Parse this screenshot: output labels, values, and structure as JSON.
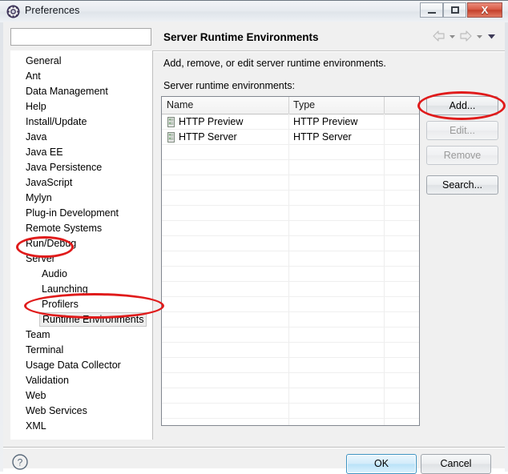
{
  "window": {
    "title": "Preferences",
    "icon": "gear-icon",
    "controls": {
      "minimize": "minimize-icon",
      "maximize": "restore-icon",
      "close": "X"
    }
  },
  "filter": {
    "value": "",
    "placeholder": ""
  },
  "sidebar": {
    "items": [
      {
        "label": "General",
        "indent": 0,
        "selected": false
      },
      {
        "label": "Ant",
        "indent": 0,
        "selected": false
      },
      {
        "label": "Data Management",
        "indent": 0,
        "selected": false
      },
      {
        "label": "Help",
        "indent": 0,
        "selected": false
      },
      {
        "label": "Install/Update",
        "indent": 0,
        "selected": false
      },
      {
        "label": "Java",
        "indent": 0,
        "selected": false
      },
      {
        "label": "Java EE",
        "indent": 0,
        "selected": false
      },
      {
        "label": "Java Persistence",
        "indent": 0,
        "selected": false
      },
      {
        "label": "JavaScript",
        "indent": 0,
        "selected": false
      },
      {
        "label": "Mylyn",
        "indent": 0,
        "selected": false
      },
      {
        "label": "Plug-in Development",
        "indent": 0,
        "selected": false
      },
      {
        "label": "Remote Systems",
        "indent": 0,
        "selected": false
      },
      {
        "label": "Run/Debug",
        "indent": 0,
        "selected": false
      },
      {
        "label": "Server",
        "indent": 0,
        "selected": false
      },
      {
        "label": "Audio",
        "indent": 1,
        "selected": false
      },
      {
        "label": "Launching",
        "indent": 1,
        "selected": false
      },
      {
        "label": "Profilers",
        "indent": 1,
        "selected": false
      },
      {
        "label": "Runtime Environments",
        "indent": 1,
        "selected": true
      },
      {
        "label": "Team",
        "indent": 0,
        "selected": false
      },
      {
        "label": "Terminal",
        "indent": 0,
        "selected": false
      },
      {
        "label": "Usage Data Collector",
        "indent": 0,
        "selected": false
      },
      {
        "label": "Validation",
        "indent": 0,
        "selected": false
      },
      {
        "label": "Web",
        "indent": 0,
        "selected": false
      },
      {
        "label": "Web Services",
        "indent": 0,
        "selected": false
      },
      {
        "label": "XML",
        "indent": 0,
        "selected": false
      }
    ]
  },
  "page": {
    "title": "Server Runtime Environments",
    "description": "Add, remove, or edit server runtime environments.",
    "list_label": "Server runtime environments:",
    "nav": {
      "back": "back-arrow-icon",
      "back_menu": "chevron-down-icon",
      "forward": "forward-arrow-icon",
      "forward_menu": "chevron-down-icon",
      "view_menu": "chevron-down-icon"
    }
  },
  "table": {
    "columns": [
      "Name",
      "Type",
      ""
    ],
    "rows": [
      {
        "icon": "server-icon",
        "name": "HTTP Preview",
        "type": "HTTP Preview"
      },
      {
        "icon": "server-icon",
        "name": "HTTP Server",
        "type": "HTTP Server"
      }
    ]
  },
  "side_buttons": [
    {
      "label": "Add...",
      "enabled": true
    },
    {
      "label": "Edit...",
      "enabled": false
    },
    {
      "label": "Remove",
      "enabled": false
    },
    {
      "label": "Search...",
      "enabled": true
    }
  ],
  "footer": {
    "help": "help-icon",
    "ok": "OK",
    "cancel": "Cancel"
  },
  "colors": {
    "annotation": "#e01b1b",
    "default_button_border": "#3c93c2",
    "close_button": "#c4402c",
    "selection": "#ededed"
  }
}
